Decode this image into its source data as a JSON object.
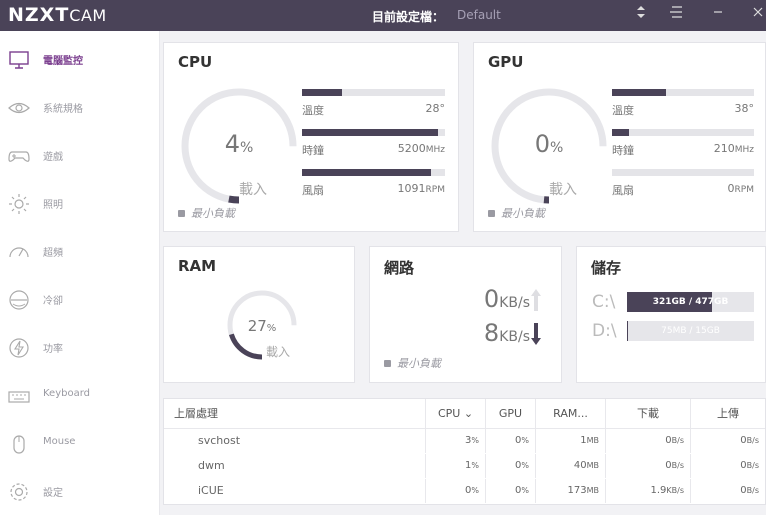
{
  "titlebar": {
    "brand": "NZXT",
    "product": "CAM",
    "profile_label": "目前設定檔：",
    "profile_value": "Default"
  },
  "sidebar": {
    "items": [
      {
        "label": "電腦監控",
        "icon": "monitor-icon",
        "active": true
      },
      {
        "label": "系統規格",
        "icon": "eye-icon",
        "active": false
      },
      {
        "label": "遊戲",
        "icon": "gamepad-icon",
        "active": false
      },
      {
        "label": "照明",
        "icon": "sun-icon",
        "active": false
      },
      {
        "label": "超頻",
        "icon": "speedometer-icon",
        "active": false
      },
      {
        "label": "冷卻",
        "icon": "fan-icon",
        "active": false
      },
      {
        "label": "功率",
        "icon": "lightning-icon",
        "active": false
      },
      {
        "label": "Keyboard",
        "icon": "keyboard-icon",
        "active": false
      },
      {
        "label": "Mouse",
        "icon": "mouse-icon",
        "active": false
      },
      {
        "label": "設定",
        "icon": "gear-icon",
        "active": false
      }
    ]
  },
  "cpu": {
    "title": "CPU",
    "load_value": "4",
    "load_unit": "%",
    "load_label": "載入",
    "load_fraction": 0.04,
    "min_load": "最小負載",
    "temp_label": "溫度",
    "temp_value": "28°",
    "temp_fraction": 0.28,
    "clock_label": "時鐘",
    "clock_value": "5200",
    "clock_unit": "MHz",
    "clock_fraction": 0.95,
    "fan_label": "風扇",
    "fan_value": "1091",
    "fan_unit": "RPM",
    "fan_fraction": 0.9
  },
  "gpu": {
    "title": "GPU",
    "load_value": "0",
    "load_unit": "%",
    "load_label": "載入",
    "load_fraction": 0.0,
    "min_load": "最小負載",
    "temp_label": "溫度",
    "temp_value": "38°",
    "temp_fraction": 0.38,
    "clock_label": "時鐘",
    "clock_value": "210",
    "clock_unit": "MHz",
    "clock_fraction": 0.12,
    "fan_label": "風扇",
    "fan_value": "0",
    "fan_unit": "RPM",
    "fan_fraction": 0.0
  },
  "ram": {
    "title": "RAM",
    "usage_value": "27",
    "usage_unit": "%",
    "usage_fraction": 0.27,
    "load_label": "載入"
  },
  "network": {
    "title": "網路",
    "up_value": "0",
    "down_value": "8",
    "unit": "KB/s",
    "min_load": "最小負載"
  },
  "storage": {
    "title": "儲存",
    "drives": [
      {
        "letter": "C:\\",
        "text": "321GB / 477GB",
        "fraction": 0.67
      },
      {
        "letter": "D:\\",
        "text": "75MB / 15GB",
        "fraction": 0.005
      }
    ]
  },
  "processes": {
    "headers": {
      "name": "上層處理",
      "cpu": "CPU",
      "gpu": "GPU",
      "ram": "RAM...",
      "down": "下載",
      "up": "上傳"
    },
    "rows": [
      {
        "name": "svchost",
        "cpu": "3",
        "cpu_unit": "%",
        "gpu": "0",
        "gpu_unit": "%",
        "ram": "1",
        "ram_unit": "MB",
        "down": "0",
        "down_unit": "B/s",
        "up": "0",
        "up_unit": "B/s"
      },
      {
        "name": "dwm",
        "cpu": "1",
        "cpu_unit": "%",
        "gpu": "0",
        "gpu_unit": "%",
        "ram": "40",
        "ram_unit": "MB",
        "down": "0",
        "down_unit": "B/s",
        "up": "0",
        "up_unit": "B/s"
      },
      {
        "name": "iCUE",
        "cpu": "0",
        "cpu_unit": "%",
        "gpu": "0",
        "gpu_unit": "%",
        "ram": "173",
        "ram_unit": "MB",
        "down": "1.9",
        "down_unit": "KB/s",
        "up": "0",
        "up_unit": "B/s"
      }
    ]
  },
  "colors": {
    "titlebar": "#4a4358",
    "accent": "#7b3f8f",
    "bar_fill": "#4a4358"
  }
}
